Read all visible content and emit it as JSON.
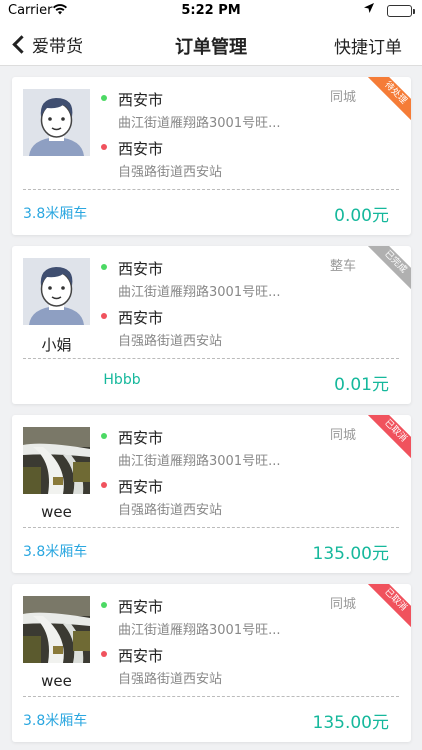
{
  "status_bar": {
    "carrier": "Carrier",
    "time": "5:22 PM"
  },
  "nav": {
    "back_label": "爱带货",
    "title": "订单管理",
    "right_action": "快捷订单"
  },
  "colors": {
    "price": "#16b89c",
    "vehicle": "#2ba7e0",
    "pending": "#f57c37",
    "completed": "#b0b0b0",
    "cancelled": "#f0525d"
  },
  "orders": [
    {
      "avatar": "cartoon-man",
      "user_name": "",
      "from_city": "西安市",
      "from_address": "曲江街道雁翔路3001号旺...",
      "to_city": "西安市",
      "to_address": "自强路街道西安站",
      "order_type": "同城",
      "status": "待处理",
      "vehicle": "3.8米厢车",
      "price": "0.00元"
    },
    {
      "avatar": "cartoon-man",
      "user_name": "小娟",
      "from_city": "西安市",
      "from_address": "曲江街道雁翔路3001号旺...",
      "to_city": "西安市",
      "to_address": "自强路街道西安站",
      "order_type": "整车",
      "status": "已完成",
      "vehicle": "Hbbb",
      "price": "0.01元"
    },
    {
      "avatar": "waterfall-photo",
      "user_name": "wee",
      "from_city": "西安市",
      "from_address": "曲江街道雁翔路3001号旺...",
      "to_city": "西安市",
      "to_address": "自强路街道西安站",
      "order_type": "同城",
      "status": "已取消",
      "vehicle": "3.8米厢车",
      "price": "135.00元"
    },
    {
      "avatar": "waterfall-photo",
      "user_name": "wee",
      "from_city": "西安市",
      "from_address": "曲江街道雁翔路3001号旺...",
      "to_city": "西安市",
      "to_address": "自强路街道西安站",
      "order_type": "同城",
      "status": "已取消",
      "vehicle": "3.8米厢车",
      "price": "135.00元"
    }
  ]
}
